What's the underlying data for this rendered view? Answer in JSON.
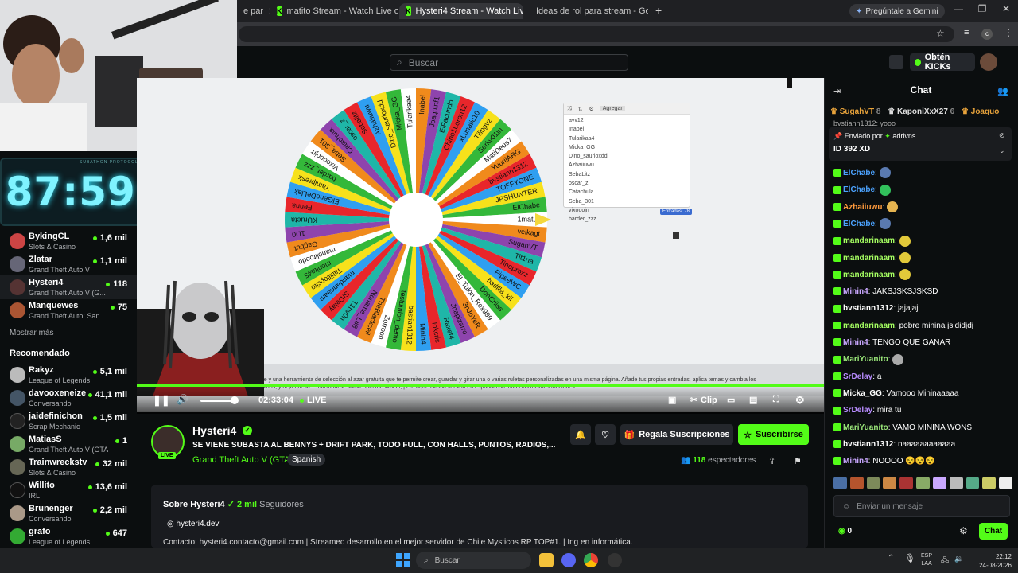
{
  "browser": {
    "tabs": [
      {
        "title": "e par"
      },
      {
        "title": "matito Stream - Watch Live on"
      },
      {
        "title": "Hysteri4 Stream - Watch Liv"
      },
      {
        "title": "Ideas de rol para stream - Goo"
      }
    ],
    "gemini_label": "Pregúntale a Gemini",
    "new_tab": "+"
  },
  "header": {
    "search_placeholder": "Buscar",
    "kicks_label": "Obtén KICKs"
  },
  "overlay": {
    "timer": "87:59:47",
    "timer_caption": "SUBATHON PROTOCOL"
  },
  "sidebar": {
    "following": [
      {
        "name": "BykingCL",
        "game": "Slots & Casino",
        "viewers": "1,6 mil",
        "color": "#c44"
      },
      {
        "name": "Zlatar",
        "game": "Grand Theft Auto V",
        "viewers": "1,1 mil",
        "color": "#667"
      },
      {
        "name": "Hysteri4",
        "game": "Grand Theft Auto V (G...",
        "viewers": "118",
        "color": "#533"
      },
      {
        "name": "Manquewes",
        "game": "Grand Theft Auto: San ...",
        "viewers": "75",
        "color": "#a53"
      }
    ],
    "show_more": "Mostrar más",
    "recommended_title": "Recomendado",
    "recommended": [
      {
        "name": "Rakyz",
        "game": "League of Legends",
        "viewers": "5,1 mil",
        "color": "#bbb"
      },
      {
        "name": "davooxeneize",
        "game": "Conversando",
        "viewers": "41,1 mil",
        "color": "#456"
      },
      {
        "name": "jaidefinichon",
        "game": "Scrap Mechanic",
        "viewers": "1,5 mil",
        "color": "#222"
      },
      {
        "name": "MatiasS",
        "game": "Grand Theft Auto V (GTA)",
        "viewers": "1",
        "color": "#7a6"
      },
      {
        "name": "Trainwreckstv",
        "game": "Slots & Casino",
        "viewers": "32 mil",
        "color": "#665"
      },
      {
        "name": "Willito",
        "game": "IRL",
        "viewers": "13,6 mil",
        "color": "#111"
      },
      {
        "name": "Brunenger",
        "game": "Conversando",
        "viewers": "2,2 mil",
        "color": "#a98"
      },
      {
        "name": "grafo",
        "game": "League of Legends",
        "viewers": "647",
        "color": "#3a3"
      }
    ]
  },
  "wheel": {
    "pointer_name": "PipeeWC",
    "segments": [
      "bvstiann1312",
      "TOFFYONE",
      "JPSHUNTER",
      "ElChabe",
      "1matux",
      "velkagt",
      "SugahVT",
      "Tit1na",
      "Tinoproxz",
      "PipeeWC",
      "badilla_kll",
      "DonCriiss",
      "El_Tulon_Rex999",
      "3nJoYeR",
      "Jnapizarro",
      "Raxet4",
      "Iokcris",
      "Minin4",
      "bastian1312",
      "testumlon_demo",
      "Zorrooh",
      "TheBlackcell",
      "Noname_L88",
      "T1bv0n",
      "SrDelay",
      "mandarinaam",
      "Tatiillopcito",
      "monita45",
      "manolitoedo",
      "Gagbut",
      "1D0",
      "KUrueta",
      "Fenna",
      "ElGenoDeLlak",
      "Yamipresk",
      "barder_zzz",
      "Vixoooojrr",
      "Seba_301",
      "Catachula",
      "oscar_z",
      "Sebalitz",
      "Azhaiiuwu",
      "Dino_saurioxdd",
      "Micka_GG",
      "Tularikaa4",
      "Inabel",
      "Joaquinf1",
      "ElFacundo",
      "Chino1Loron12",
      "xLunatic10",
      "Tilingvz",
      "Serkv01tn",
      "MatiDeus7",
      "YuuriiARG"
    ],
    "editor_toolbar": "Agregar",
    "editor_entries": [
      "avv12",
      "Inabel",
      "Tularikaa4",
      "Micka_GG",
      "Dino_saurioxdd",
      "Azhaiiuwu",
      "SebaLitz",
      "oscar_z",
      "Catachula",
      "Seba_301",
      "vixooojrr",
      "barder_zzz"
    ],
    "entries_badge": "Entradas: 78",
    "description": "...ne y una herramienta de selección al azar gratuita que te permite crear, guardar y girar una o varias ruletas personalizadas en una misma página. Añade tus propias entradas, aplica temas y cambia los sonidos, y deja que la ...rnacional se llama Spin the Wheel, pero aquí usas la versión en español con todas las mismas funciones."
  },
  "player": {
    "elapsed": "02:33:04",
    "live_label": "LIVE",
    "clip_label": "Clip"
  },
  "stream": {
    "streamer": "Hysteri4",
    "live_badge": "LIVE",
    "title": "SE VIENE SUBASTA AL BENNYS + DRIFT PARK, TODO FULL, CON HALLS, PUNTOS, RADIOS,...",
    "category": "Grand Theft Auto V (GTA)",
    "language": "Spanish",
    "gift_subs": "Regala Suscripciones",
    "subscribe": "Suscribirse",
    "viewers_count": "118",
    "viewers_label": "espectadores"
  },
  "about": {
    "title": "Sobre Hysteri4",
    "followers_count": "2 mil",
    "followers_label": "Seguidores",
    "link": "hysteri4.dev",
    "contact": "Contacto: hysteri4.contacto@gmail.com | Streameo desarrollo en el mejor servidor de Chile Mysticos RP TOP#1. | Ing en informática."
  },
  "chat": {
    "title": "Chat",
    "leaderboard": [
      {
        "name": "SugahVT",
        "count": "8",
        "color": "#e8a33b"
      },
      {
        "name": "KaponiXxX27",
        "count": "6",
        "color": "#ddd"
      },
      {
        "name": "Joaquo",
        "count": "",
        "color": "#e8a33b"
      }
    ],
    "pinned_above": "bvstiann1312: yooo",
    "pinned_sent_by": "Enviado por",
    "pinned_user": "adrivns",
    "pinned_text": "ID 392 XD",
    "messages": [
      {
        "user": "ElChabe",
        "text": "",
        "color": "#4ca3ff",
        "emote": "#5a7ab0"
      },
      {
        "user": "ElChabe",
        "text": "",
        "color": "#4ca3ff",
        "emote": "#32c15c"
      },
      {
        "user": "Azhaiiuwu",
        "text": "",
        "color": "#ff9a3c",
        "emote": "#e6b450"
      },
      {
        "user": "ElChabe",
        "text": "",
        "color": "#4ca3ff",
        "emote": "#5a7ab0"
      },
      {
        "user": "mandarinaam",
        "text": "",
        "color": "#a6ff62",
        "emote": "#e2c93a"
      },
      {
        "user": "mandarinaam",
        "text": "",
        "color": "#a6ff62",
        "emote": "#e2c93a"
      },
      {
        "user": "mandarinaam",
        "text": "",
        "color": "#a6ff62",
        "emote": "#e2c93a"
      },
      {
        "user": "Minin4",
        "text": "JAKSJSKSJSKSD",
        "color": "#c9a7ff",
        "emote": ""
      },
      {
        "user": "bvstiann1312",
        "text": "jajajaj",
        "color": "#ffffff",
        "emote": ""
      },
      {
        "user": "mandarinaam",
        "text": "pobre minina jsjdidjdj",
        "color": "#a6ff62",
        "emote": ""
      },
      {
        "user": "Minin4",
        "text": "TENGO QUE GANAR",
        "color": "#c9a7ff",
        "emote": ""
      },
      {
        "user": "MariYuanito",
        "text": "",
        "color": "#9be87a",
        "emote": "#aaa"
      },
      {
        "user": "SrDelay",
        "text": "a",
        "color": "#b88cff",
        "emote": ""
      },
      {
        "user": "Micka_GG",
        "text": "Vamooo Mininaaaaa",
        "color": "#ffffff",
        "emote": ""
      },
      {
        "user": "SrDelay",
        "text": "mira tu",
        "color": "#b88cff",
        "emote": ""
      },
      {
        "user": "MariYuanito",
        "text": "VAMO MININA WONS",
        "color": "#9be87a",
        "emote": ""
      },
      {
        "user": "bvstiann1312",
        "text": "naaaaaaaaaaaa",
        "color": "#ffffff",
        "emote": ""
      },
      {
        "user": "Minin4",
        "text": "NOOOO 😵😵😵",
        "color": "#c9a7ff",
        "emote": ""
      }
    ],
    "input_placeholder": "Enviar un mensaje",
    "kicks_count": "0",
    "send_label": "Chat"
  },
  "taskbar": {
    "search_label": "Buscar",
    "lang_top": "ESP",
    "lang_bottom": "LAA",
    "time": "22:12",
    "date": "24-08-2026"
  },
  "colors": {
    "kick_green": "#53fc18",
    "background": "#0b0e0f",
    "timer_cyan": "#7ff3ff"
  }
}
